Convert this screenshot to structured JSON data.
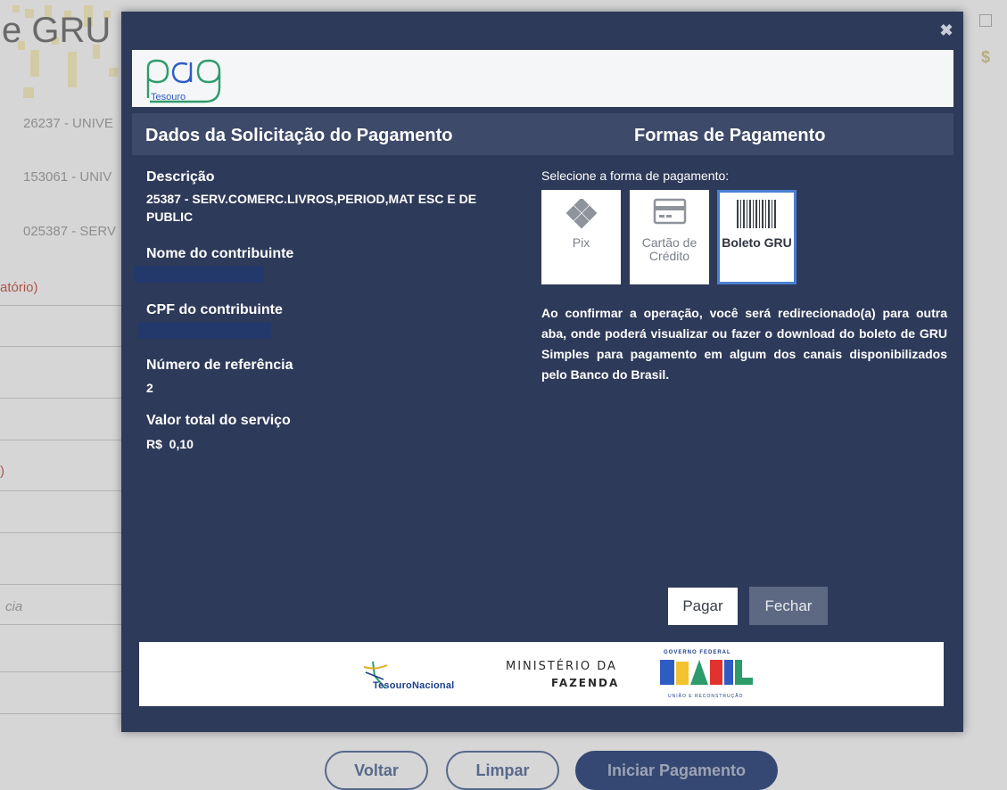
{
  "background": {
    "title": "e GRU",
    "list_items": [
      "26237 - UNIVE",
      "153061 - UNIV",
      "025387 - SERV"
    ],
    "label_required": "atório)",
    "label_paren": ")",
    "italic_hint": "cia",
    "buttons": {
      "back": "Voltar",
      "clear": "Limpar",
      "start": "Iniciar Pagamento"
    }
  },
  "modal": {
    "close_symbol": "✖",
    "brand": {
      "pag": "pag",
      "tesouro": "Tesouro"
    },
    "left_header": "Dados da Solicitação do Pagamento",
    "right_header": "Formas de Pagamento",
    "fields": {
      "description_label": "Descrição",
      "description_value": "25387 - SERV.COMERC.LIVROS,PERIOD,MAT ESC E DE PUBLIC",
      "taxpayer_name_label": "Nome do contribuinte",
      "taxpayer_cpf_label": "CPF do contribuinte",
      "reference_label": "Número de referência",
      "reference_value": "2",
      "total_label": "Valor total do serviço",
      "total_value": "R$  0,10"
    },
    "payment": {
      "select_label": "Selecione a forma de pagamento:",
      "options": [
        {
          "label": "Pix",
          "icon": "pix-icon",
          "selected": false
        },
        {
          "label": "Cartão de Crédito",
          "icon": "credit-card-icon",
          "selected": false
        },
        {
          "label": "Boleto GRU",
          "icon": "barcode-icon",
          "selected": true
        }
      ],
      "info": "Ao confirmar a operação, você será redirecionado(a) para outra aba, onde poderá visualizar ou fazer o download do boleto de GRU Simples para pagamento em algum dos canais disponibilizados pelo Banco do Brasil."
    },
    "actions": {
      "pay": "Pagar",
      "close": "Fechar"
    },
    "footer": {
      "tesouro": "TesouroNacional",
      "ministerio_line1": "MINISTÉRIO DA",
      "ministerio_line2": "FAZENDA",
      "gov_top": "GOVERNO FEDERAL",
      "brasil": "BRASIL",
      "gov_bottom": "UNIÃO E RECONSTRUÇÃO"
    },
    "colors": {
      "modal_bg": "#2e3a59",
      "header_bg": "#3d4a69",
      "selected_border": "#4a7fd4",
      "pag_green": "#2e9b6b",
      "pag_blue": "#2f5cc4"
    }
  }
}
